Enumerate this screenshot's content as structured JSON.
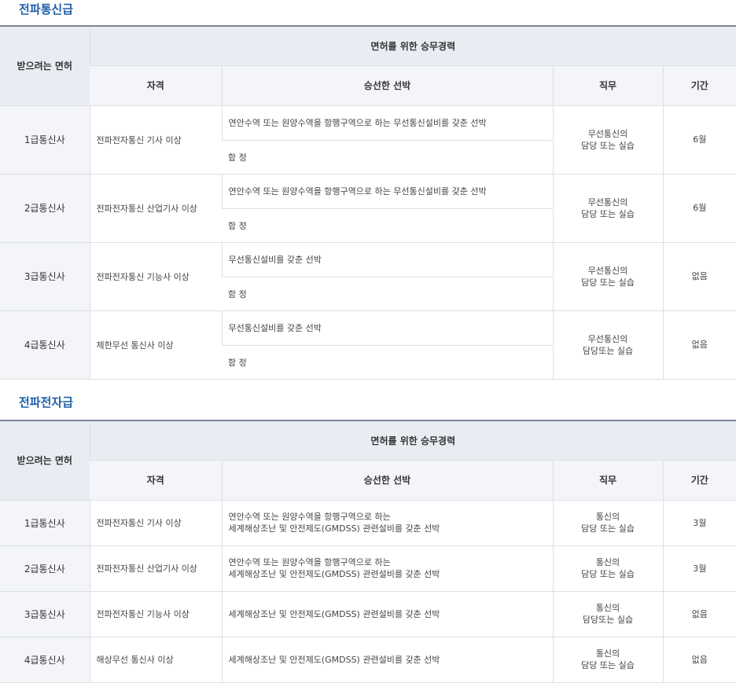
{
  "sections": [
    {
      "title": "전파통신급",
      "header": {
        "license": "받으려는 면허",
        "experience": "면허를 위한 승무경력",
        "qualification": "자격",
        "ship": "승선한 선박",
        "duty": "직무",
        "period": "기간"
      },
      "rows": [
        {
          "license": "1급통신사",
          "qualification": "전파전자통신 기사 이상",
          "ship_a": "연안수역 또는 원양수역을 항행구역으로 하는 무선통신설비를 갖춘 선박",
          "ship_b": "함 정",
          "duty_1": "무선통신의",
          "duty_2": "담당 또는 실습",
          "period": "6월"
        },
        {
          "license": "2급통신사",
          "qualification": "전파전자통신 산업기사 이상",
          "ship_a": "연안수역 또는 원양수역을 항행구역으로 하는 무선통신설비를 갖춘 선박",
          "ship_b": "함 정",
          "duty_1": "무선통신의",
          "duty_2": "담당 또는 실습",
          "period": "6월"
        },
        {
          "license": "3급통신사",
          "qualification": "전파전자통신 기능사 이상",
          "ship_a": "무선통신설비를 갖춘 선박",
          "ship_b": "함 정",
          "duty_1": "무선통신의",
          "duty_2": "담당 또는 실습",
          "period": "없음"
        },
        {
          "license": "4급통신사",
          "qualification": "제한무선 통신사 이상",
          "ship_a": "무선통신설비를 갖춘 선박",
          "ship_b": "함 정",
          "duty_1": "무선통신의",
          "duty_2": "담당또는 실습",
          "period": "없음"
        }
      ]
    },
    {
      "title": "전파전자급",
      "header": {
        "license": "받으려는 면허",
        "experience": "면허를 위한 승무경력",
        "qualification": "자격",
        "ship": "승선한 선박",
        "duty": "직무",
        "period": "기간"
      },
      "rows": [
        {
          "license": "1급통신사",
          "qualification": "전파전자통신 기사 이상",
          "ship_1": "연안수역 또는 원양수역을 항행구역으로 하는",
          "ship_2": "세계해상조난 및 안전제도(GMDSS) 관련설비를 갖춘 선박",
          "duty_1": "통신의",
          "duty_2": "담당 또는 실습",
          "period": "3월"
        },
        {
          "license": "2급통신사",
          "qualification": "전파전자통신 산업기사 이상",
          "ship_1": "연안수역 또는 원양수역을 항행구역으로 하는",
          "ship_2": "세계해상조난 및 안전제도(GMDSS) 관련설비를 갖춘 선박",
          "duty_1": "통신의",
          "duty_2": "담당 또는 실습",
          "period": "3월"
        },
        {
          "license": "3급통신사",
          "qualification": "전파전자통신 기능사 이상",
          "ship_1": "세계해상조난 및 안전제도(GMDSS) 관련설비를 갖춘 선박",
          "ship_2": "",
          "duty_1": "통신의",
          "duty_2": "담당또는 실습",
          "period": "없음"
        },
        {
          "license": "4급통신사",
          "qualification": "해상무선 통신사 이상",
          "ship_1": "세계해상조난 및 안전제도(GMDSS) 관련설비를 갖춘 선박",
          "ship_2": "",
          "duty_1": "통신의",
          "duty_2": "담당 또는 실습",
          "period": "없음"
        }
      ]
    }
  ]
}
